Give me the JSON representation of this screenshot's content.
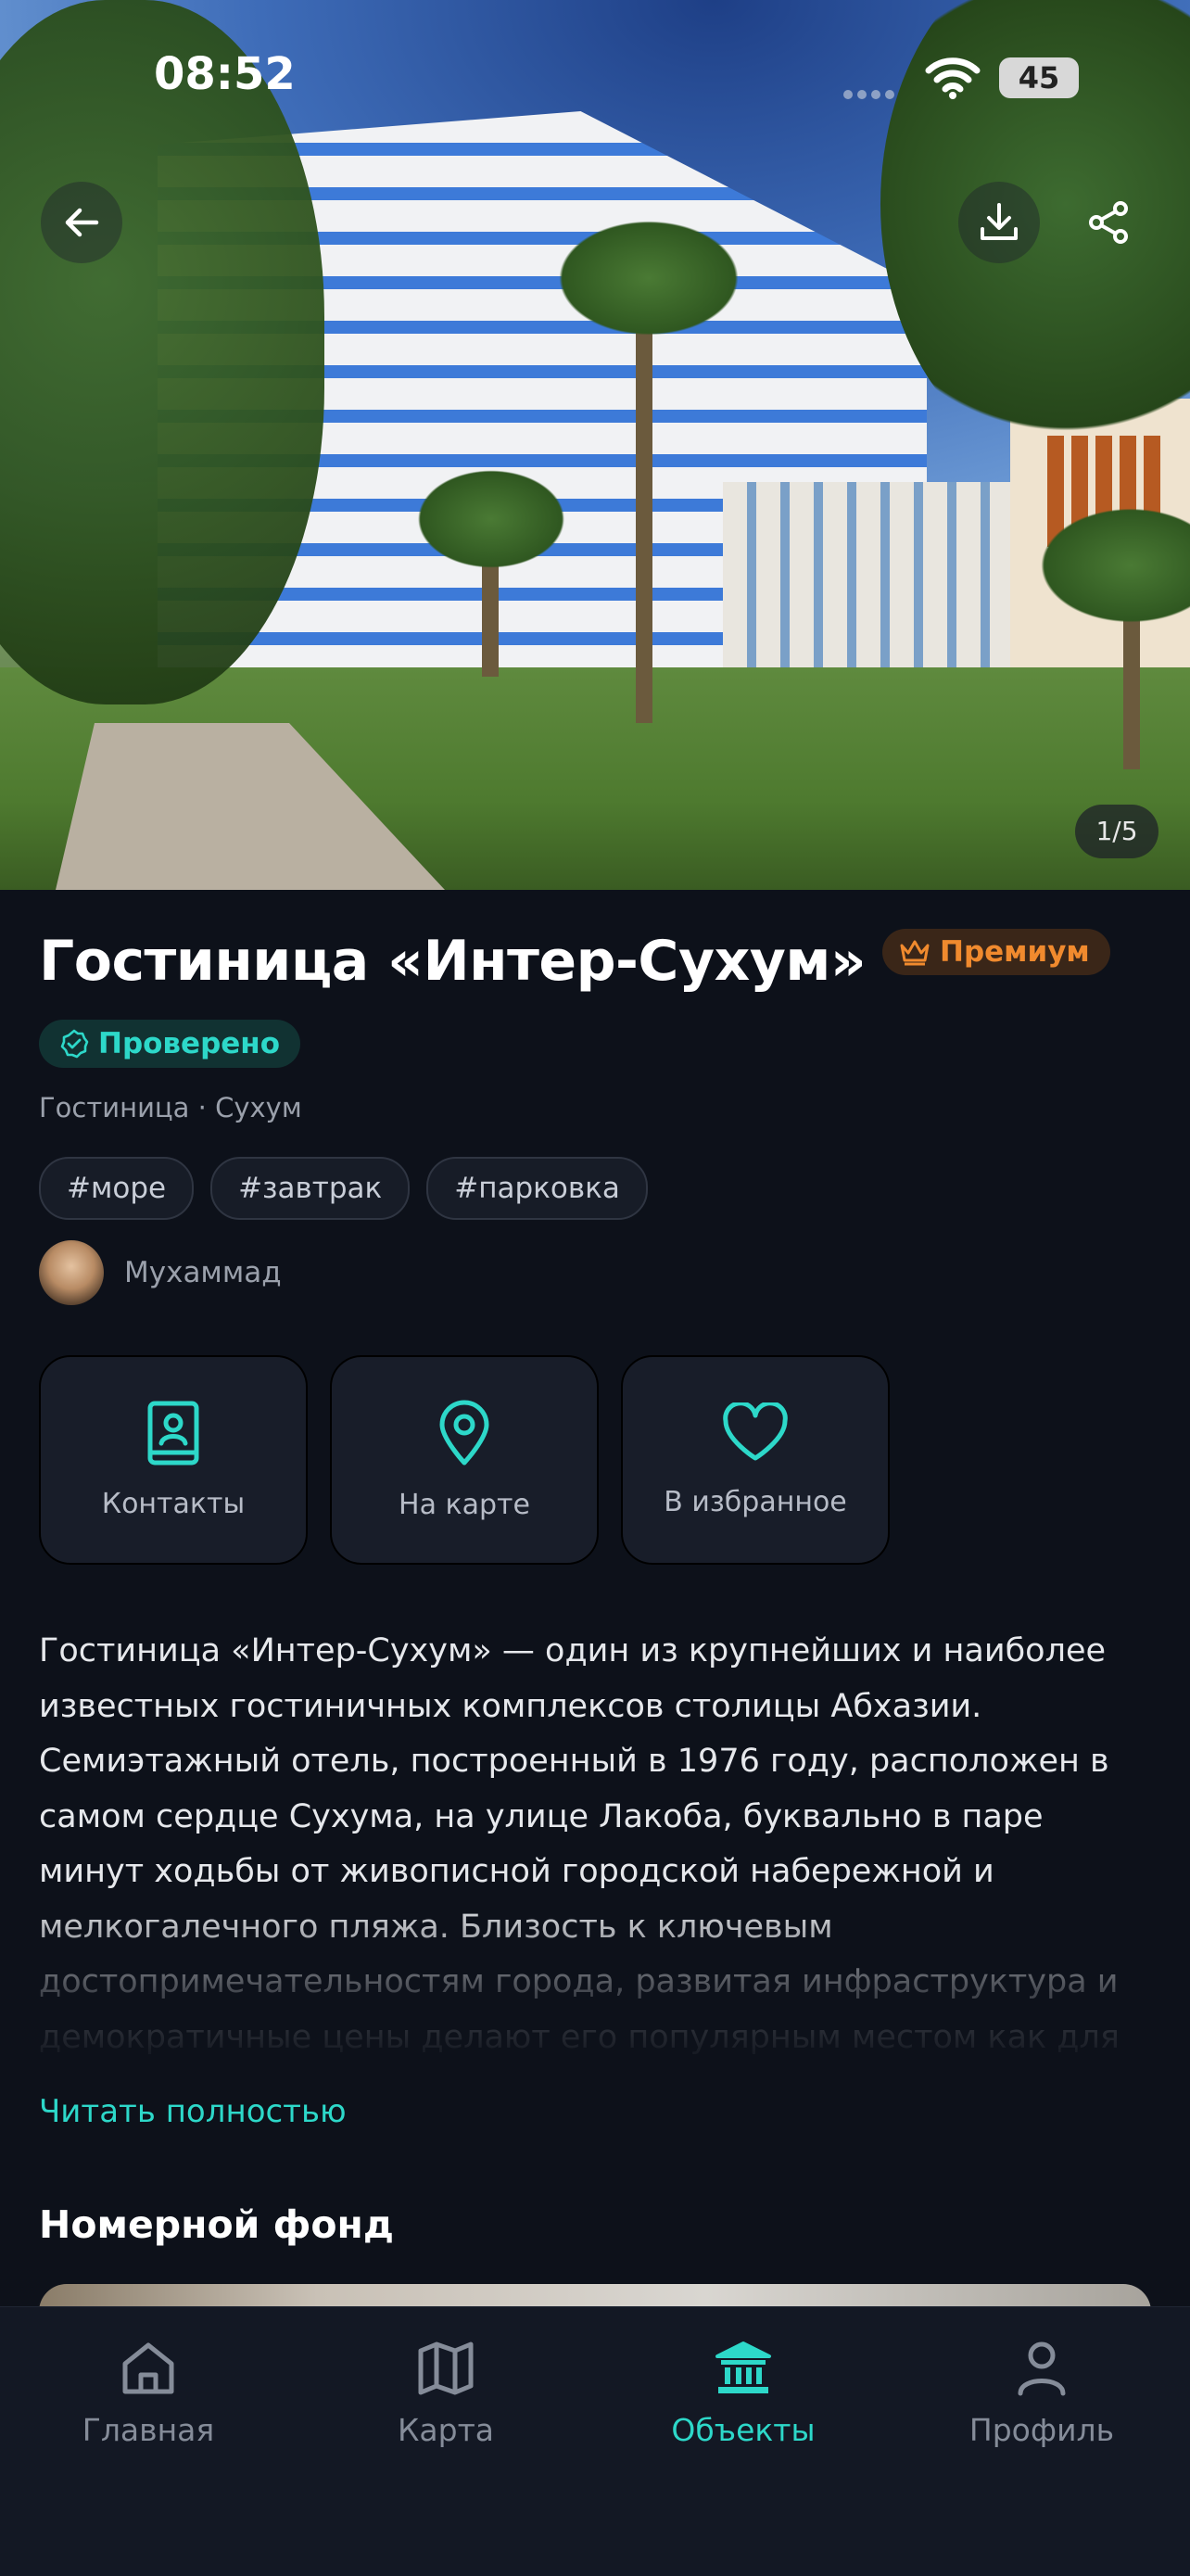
{
  "status_bar": {
    "time": "08:52",
    "battery": "45"
  },
  "gallery": {
    "counter": "1/5"
  },
  "hotel": {
    "title": "Гостиница «Интер-Сухум»",
    "premium_badge": "Премиум",
    "verified_badge": "Проверено",
    "subtitle": "Гостиница · Сухум",
    "tags": [
      "#море",
      "#завтрак",
      "#парковка"
    ],
    "author": "Мухаммад"
  },
  "actions": [
    {
      "label": "Контакты",
      "icon": "contact-book-icon"
    },
    {
      "label": "На карте",
      "icon": "map-pin-icon"
    },
    {
      "label": "В избранное",
      "icon": "heart-icon"
    }
  ],
  "description": "Гостиница «Интер-Сухум» — один из крупнейших и наиболее известных гостиничных комплексов столицы Абхазии. Семиэтажный отель, построенный в 1976 году, расположен в самом сердце Сухума, на улице Лакоба, буквально в паре минут ходьбы от живописной городской набережной и мелкогалечного пляжа. Близость к ключевым достопримечательностям города, развитая инфраструктура и демократичные цены делают его популярным местом как для",
  "read_more": "Читать полностью",
  "rooms_section_title": "Номерной фонд",
  "tabs": [
    {
      "label": "Главная",
      "icon": "home-icon"
    },
    {
      "label": "Карта",
      "icon": "map-icon"
    },
    {
      "label": "Объекты",
      "icon": "museum-icon",
      "active": true
    },
    {
      "label": "Профиль",
      "icon": "profile-icon"
    }
  ],
  "colors": {
    "accent": "#2dd8c9",
    "premium": "#f08a2e",
    "background": "#0d111a",
    "card": "#181d29"
  }
}
